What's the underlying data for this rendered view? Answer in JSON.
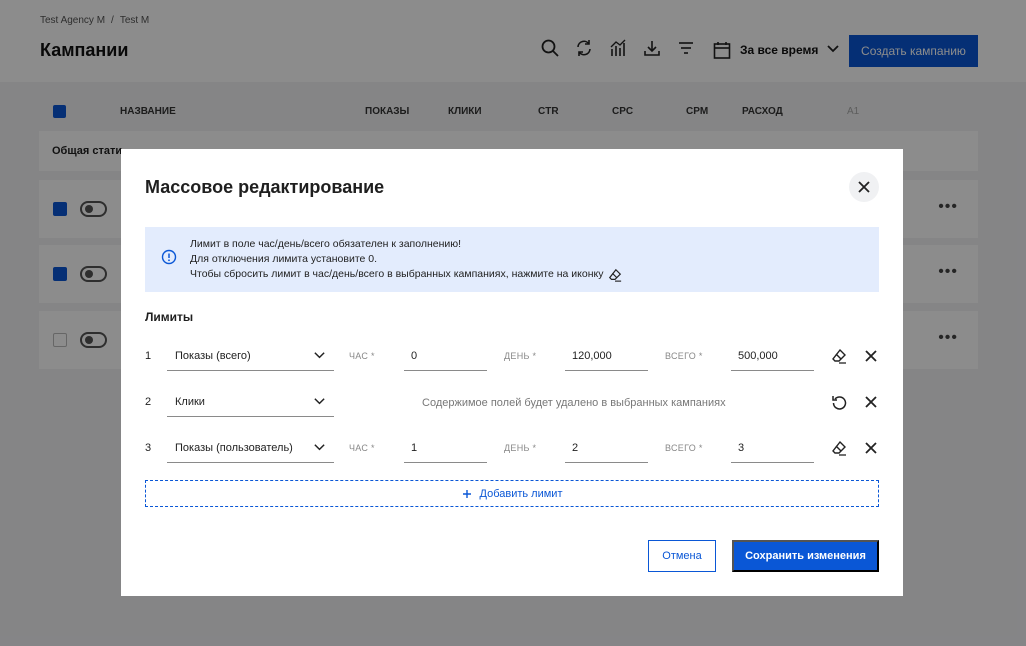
{
  "breadcrumb": {
    "agency": "Test Agency M",
    "separator": "/",
    "client": "Test M"
  },
  "page": {
    "title": "Кампании"
  },
  "toolbar": {
    "icons": [
      "search-icon",
      "refresh-icon",
      "chart-icon",
      "download-icon",
      "filter-icon",
      "calendar-icon"
    ],
    "period_label": "За все время",
    "create_label": "Создать кампанию"
  },
  "table": {
    "columns": [
      "НАЗВАНИЕ",
      "ПОКАЗЫ",
      "КЛИКИ",
      "CTR",
      "CPC",
      "CPM",
      "РАСХОД",
      "A1"
    ],
    "summary_label": "Общая стати"
  },
  "modal": {
    "title": "Массовое редактирование",
    "info_lines": [
      "Лимит в поле час/день/всего обязателен к заполнению!",
      "Для отключения лимита установите 0.",
      "Чтобы сбросить лимит в час/день/всего в выбранных кампаниях, нажмите на иконку"
    ],
    "section_title": "Лимиты",
    "labels": {
      "hour": "ЧАС *",
      "day": "ДЕНЬ *",
      "total": "ВСЕГО *"
    },
    "limits": [
      {
        "num": "1",
        "type": "Показы (всего)",
        "hour": "0",
        "day": "120,000",
        "total": "500,000"
      },
      {
        "num": "2",
        "type": "Клики",
        "note": "Содержимое полей будет удалено в выбранных кампаниях"
      },
      {
        "num": "3",
        "type": "Показы (пользователь)",
        "hour": "1",
        "day": "2",
        "total": "3"
      }
    ],
    "add_limit_label": "Добавить лимит",
    "cancel_label": "Отмена",
    "save_label": "Сохранить изменения"
  },
  "colors": {
    "accent": "#0a57d6",
    "info_bg": "#e3ecfd"
  }
}
